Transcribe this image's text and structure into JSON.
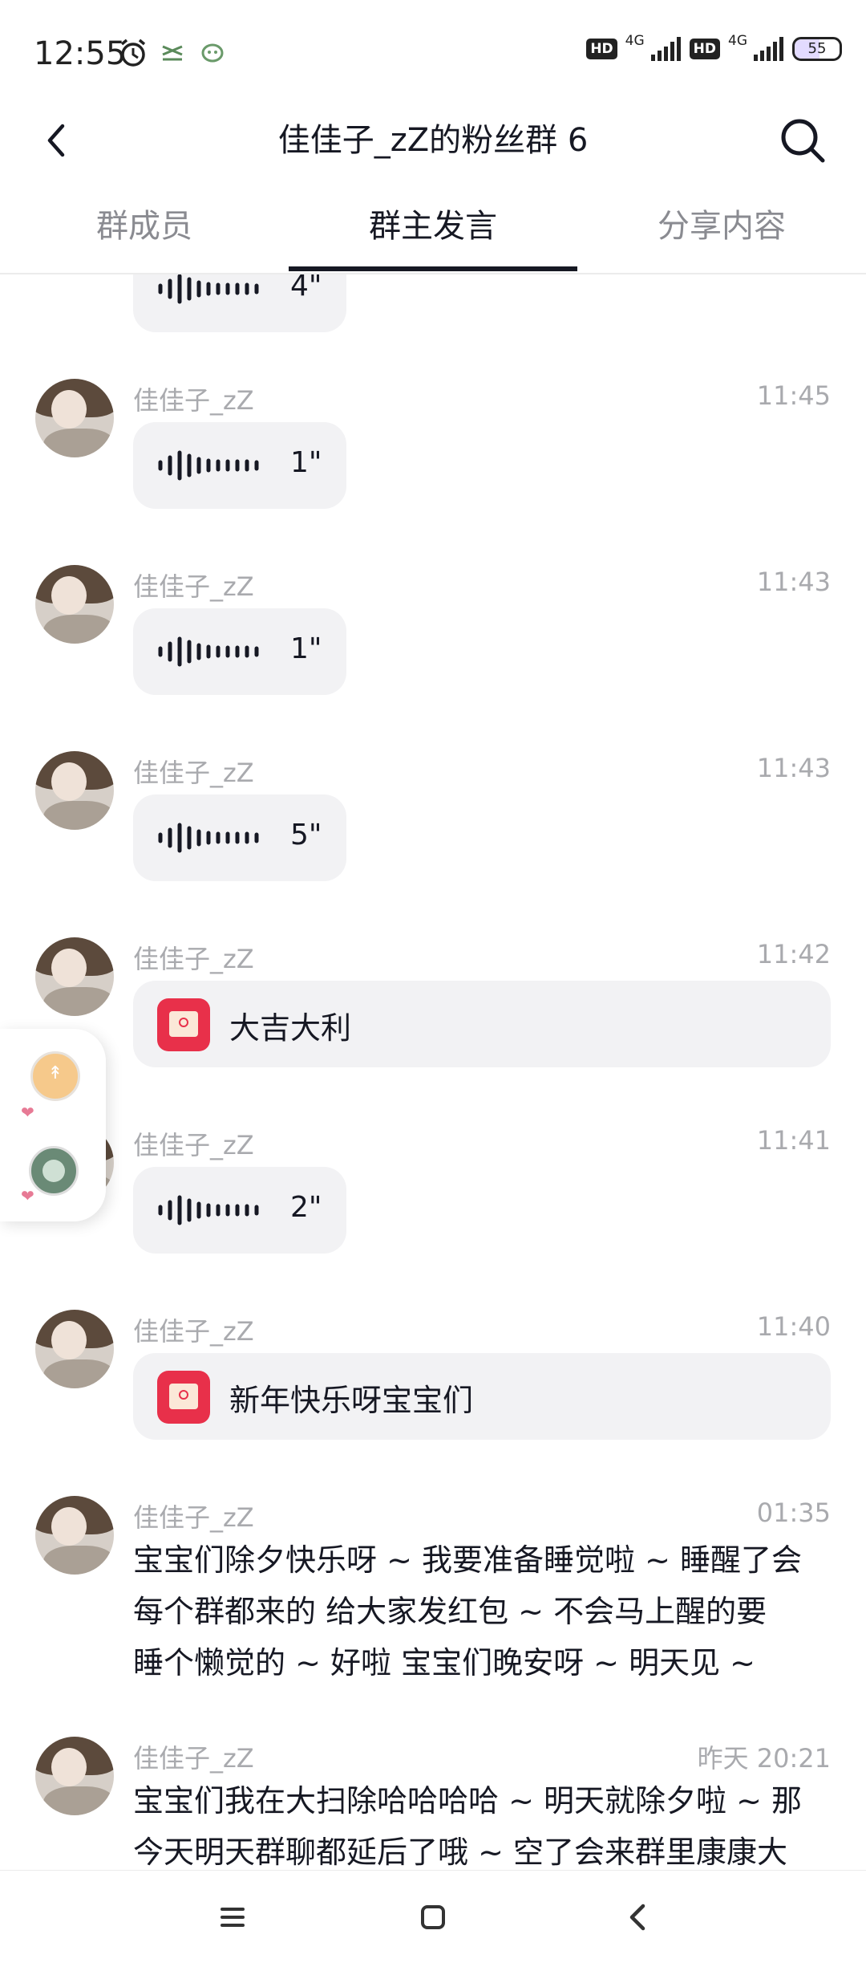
{
  "status_bar": {
    "time": "12:55",
    "network_1": "4G",
    "network_2": "4G",
    "hd_1": "HD",
    "hd_2": "HD",
    "battery": "55",
    "battery_level": 0.55
  },
  "nav": {
    "title": "佳佳子_zZ的粉丝群 6"
  },
  "tabs": [
    {
      "label": "群成员",
      "active": false
    },
    {
      "label": "群主发言",
      "active": true
    },
    {
      "label": "分享内容",
      "active": false
    }
  ],
  "messages": [
    {
      "type": "voice",
      "duration": "4\""
    },
    {
      "type": "voice",
      "sender": "佳佳子_zZ",
      "time": "11:45",
      "duration": "1\""
    },
    {
      "type": "voice",
      "sender": "佳佳子_zZ",
      "time": "11:43",
      "duration": "1\""
    },
    {
      "type": "voice",
      "sender": "佳佳子_zZ",
      "time": "11:43",
      "duration": "5\""
    },
    {
      "type": "red_packet",
      "sender": "佳佳子_zZ",
      "time": "11:42",
      "text": "大吉大利"
    },
    {
      "type": "voice",
      "sender": "佳佳子_zZ",
      "time": "11:41",
      "duration": "2\""
    },
    {
      "type": "red_packet",
      "sender": "佳佳子_zZ",
      "time": "11:40",
      "text": "新年快乐呀宝宝们"
    },
    {
      "type": "text",
      "sender": "佳佳子_zZ",
      "time": "01:35",
      "lines": [
        "宝宝们除夕快乐呀 ~ 我要准备睡觉啦 ~ 睡醒了会",
        "每个群都来的 给大家发红包 ~ 不会马上醒的要",
        "睡个懒觉的 ~ 好啦 宝宝们晚安呀 ~ 明天见 ~"
      ]
    },
    {
      "type": "text",
      "sender": "佳佳子_zZ",
      "time": "昨天 20:21",
      "lines": [
        "宝宝们我在大扫除哈哈哈哈 ~ 明天就除夕啦 ~ 那",
        "今天明天群聊都延后了哦 ~ 空了会来群里康康大"
      ]
    }
  ],
  "float_widget": {
    "coin_symbol": "↟"
  }
}
